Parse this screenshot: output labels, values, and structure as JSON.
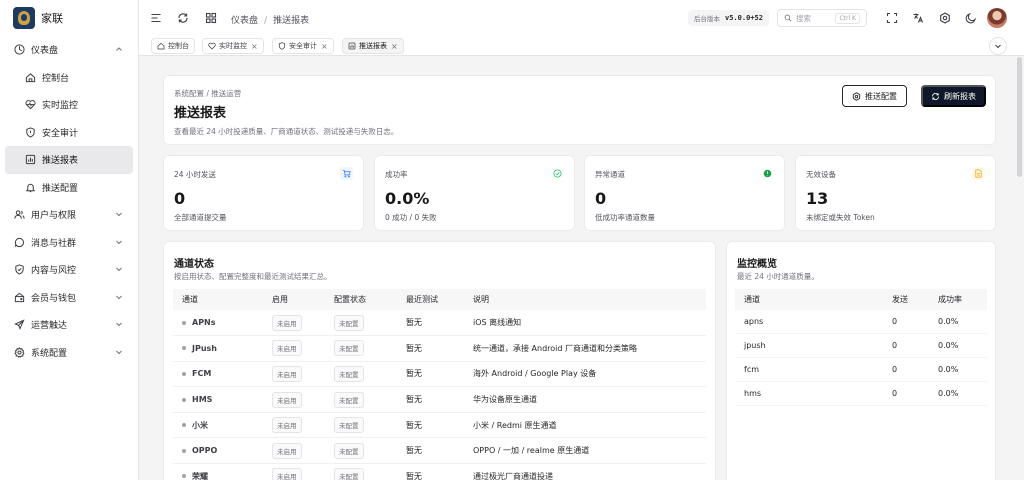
{
  "app": {
    "name": "家联"
  },
  "sidebar": {
    "items": [
      {
        "label": "仪表盘",
        "icon": "gauge-icon",
        "level": 0,
        "expanded": true
      },
      {
        "label": "控制台",
        "icon": "home-icon",
        "level": 1
      },
      {
        "label": "实时监控",
        "icon": "heart-pulse-icon",
        "level": 1
      },
      {
        "label": "安全审计",
        "icon": "shield-alert-icon",
        "level": 1
      },
      {
        "label": "推送报表",
        "icon": "chart-icon",
        "level": 1,
        "active": true
      },
      {
        "label": "推送配置",
        "icon": "bell-icon",
        "level": 1
      },
      {
        "label": "用户与权限",
        "icon": "users-icon",
        "level": 0
      },
      {
        "label": "消息与社群",
        "icon": "message-icon",
        "level": 0
      },
      {
        "label": "内容与风控",
        "icon": "shield-check-icon",
        "level": 0
      },
      {
        "label": "会员与钱包",
        "icon": "wallet-icon",
        "level": 0
      },
      {
        "label": "运营触达",
        "icon": "send-icon",
        "level": 0
      },
      {
        "label": "系统配置",
        "icon": "settings-icon",
        "level": 0
      }
    ]
  },
  "header": {
    "breadcrumb": [
      "仪表盘",
      "推送报表"
    ],
    "version_label": "后台版本",
    "version_value": "v5.0.0+52",
    "search_placeholder": "搜索",
    "search_shortcut": "Ctrl K"
  },
  "tabs": [
    {
      "label": "控制台",
      "icon": "home-icon",
      "closable": false
    },
    {
      "label": "实时监控",
      "icon": "heart-pulse-icon",
      "closable": true
    },
    {
      "label": "安全审计",
      "icon": "shield-alert-icon",
      "closable": true
    },
    {
      "label": "推送报表",
      "icon": "chart-icon",
      "closable": true,
      "active": true
    }
  ],
  "page": {
    "breadcrumb": "系统配置 / 推送运营",
    "title": "推送报表",
    "description": "查看最近 24 小时投递质量、厂商通道状态、测试投递与失败日志。",
    "config_button": "推送配置",
    "refresh_button": "刷新报表"
  },
  "stats": [
    {
      "label": "24 小时发送",
      "value": "0",
      "sub": "全部通道提交量",
      "icon": "cart-icon",
      "color": "#3b82f6"
    },
    {
      "label": "成功率",
      "value": "0.0%",
      "sub": "0 成功 / 0 失败",
      "icon": "check-circle-icon",
      "color": "#22c55e"
    },
    {
      "label": "异常通道",
      "value": "0",
      "sub": "低成功率通道数量",
      "icon": "alert-circle-icon",
      "color": "#16a34a"
    },
    {
      "label": "无效设备",
      "value": "13",
      "sub": "未绑定或失效 Token",
      "icon": "file-icon",
      "color": "#f59e0b"
    }
  ],
  "channels": {
    "title": "通道状态",
    "description": "按启用状态、配置完整度和最近测试结果汇总。",
    "columns": [
      "通道",
      "启用",
      "配置状态",
      "最近测试",
      "说明"
    ],
    "rows": [
      {
        "name": "APNs",
        "enabled": "未启用",
        "config": "未配置",
        "last_test": "暂无",
        "note": "iOS 离线通知"
      },
      {
        "name": "JPush",
        "enabled": "未启用",
        "config": "未配置",
        "last_test": "暂无",
        "note": "统一通道，承接 Android 厂商通道和分类策略"
      },
      {
        "name": "FCM",
        "enabled": "未启用",
        "config": "未配置",
        "last_test": "暂无",
        "note": "海外 Android / Google Play 设备"
      },
      {
        "name": "HMS",
        "enabled": "未启用",
        "config": "未配置",
        "last_test": "暂无",
        "note": "华为设备原生通道"
      },
      {
        "name": "小米",
        "enabled": "未启用",
        "config": "未配置",
        "last_test": "暂无",
        "note": "小米 / Redmi 原生通道"
      },
      {
        "name": "OPPO",
        "enabled": "未启用",
        "config": "未配置",
        "last_test": "暂无",
        "note": "OPPO / 一加 / realme 原生通道"
      },
      {
        "name": "荣耀",
        "enabled": "未启用",
        "config": "未配置",
        "last_test": "暂无",
        "note": "通过极光厂商通道投递"
      }
    ]
  },
  "monitor": {
    "title": "监控概览",
    "description": "最近 24 小时通道质量。",
    "columns": [
      "通道",
      "发送",
      "成功率"
    ],
    "rows": [
      {
        "channel": "apns",
        "sent": "0",
        "rate": "0.0%"
      },
      {
        "channel": "jpush",
        "sent": "0",
        "rate": "0.0%"
      },
      {
        "channel": "fcm",
        "sent": "0",
        "rate": "0.0%"
      },
      {
        "channel": "hms",
        "sent": "0",
        "rate": "0.0%"
      }
    ]
  }
}
